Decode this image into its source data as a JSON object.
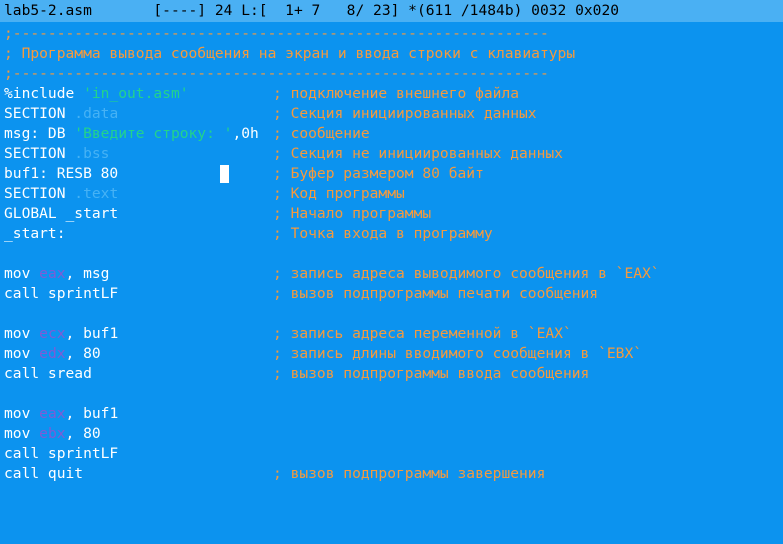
{
  "status": {
    "filename": "lab5-2.asm",
    "info": "       [----] 24 L:[  1+ 7   8/ 23] *(611 /1484b) 0032 0x020"
  },
  "lines": {
    "l1": ";-------------------------------------------------------------",
    "l2": "; Программа вывода сообщения на экран и ввода строки с клавиатуры",
    "l3": ";-------------------------------------------------------------",
    "l4": {
      "a": "%include ",
      "b": "'in_out.asm'",
      "c": "; подключение внешнего файла"
    },
    "l5": {
      "a": "SECTION ",
      "b": ".data",
      "c": "; Секция инициированных данных"
    },
    "l6": {
      "a": "msg: DB ",
      "b": "'Введите строку: '",
      "d": ",0h",
      "c": "; сообщение"
    },
    "l7": {
      "a": "SECTION ",
      "b": ".bss",
      "c": "; Секция не инициированных данных"
    },
    "l8": {
      "a": "buf1: RESB 80",
      "c": "; Буфер размером 80 байт"
    },
    "l9": {
      "a": "SECTION ",
      "b": ".text",
      "c": "; Код программы"
    },
    "l10": {
      "a": "GLOBAL _start",
      "c": "; Начало программы"
    },
    "l11": {
      "a": "_start:",
      "c": "; Точка входа в программу"
    },
    "l13": {
      "a": "mov ",
      "r": "eax",
      "d": ", msg",
      "c": "; запись адреса выводимого сообщения в `EAX`"
    },
    "l14": {
      "a": "call sprintLF",
      "c": "; вызов подпрограммы печати сообщения"
    },
    "l16": {
      "a": "mov ",
      "r": "ecx",
      "d": ", buf1",
      "c": "; запись адреса переменной в `EAX`"
    },
    "l17": {
      "a": "mov ",
      "r": "edx",
      "d": ", 80",
      "c": "; запись длины вводимого сообщения в `EBX`"
    },
    "l18": {
      "a": "call sread",
      "c": "; вызов подпрограммы ввода сообщения"
    },
    "l20": {
      "a": "mov ",
      "r": "eax",
      "d": ", buf1"
    },
    "l21": {
      "a": "mov ",
      "r": "ebx",
      "d": ", 80"
    },
    "l22": {
      "a": "call sprintLF"
    },
    "l23": {
      "a": "call quit",
      "c": "; вызов подпрограммы завершения"
    }
  },
  "colors": {
    "background": "#0c93ef",
    "comment": "#f59a3d",
    "string": "#22d38c",
    "section_name": "#46b2f5",
    "register": "#7d5cd6"
  }
}
